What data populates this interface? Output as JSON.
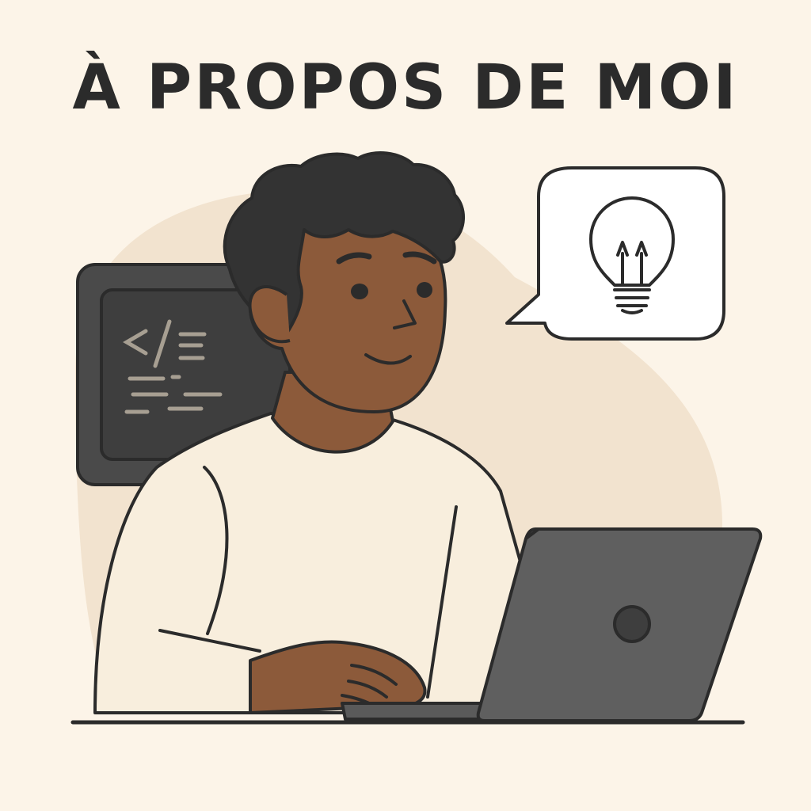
{
  "page": {
    "title": "À PROPOS DE MOI"
  },
  "illustration": {
    "monitor_icon": "code-brackets-icon",
    "speech_bubble_icon": "lightbulb-icon",
    "laptop_icon": "camera-dot-icon"
  },
  "colors": {
    "background": "#FCF4E8",
    "blob": "#F2E3CF",
    "ink": "#2B2B2B",
    "skin": "#8C5A3A",
    "sweater": "#F8EEDD",
    "laptop": "#5F5F5F",
    "monitor": "#4A4A4A",
    "monitor_screen": "#3E3E3E",
    "code_lines": "#A79F92"
  }
}
